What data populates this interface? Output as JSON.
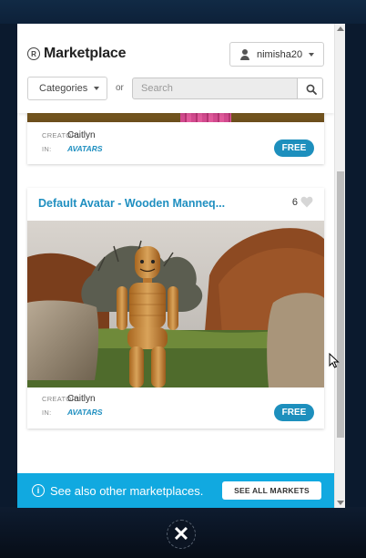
{
  "header": {
    "title": "Marketplace",
    "user_name": "nimisha20",
    "categories_label": "Categories",
    "or_label": "or",
    "search_placeholder": "Search"
  },
  "listings": [
    {
      "creator_key": "CREATOR:",
      "creator": "Caitlyn",
      "in_key": "IN:",
      "category": "AVATARS",
      "price_label": "FREE"
    },
    {
      "title": "Default Avatar - Wooden Manneq...",
      "likes": "6",
      "creator_key": "CREATOR:",
      "creator": "Caitlyn",
      "in_key": "IN:",
      "category": "AVATARS",
      "price_label": "FREE"
    }
  ],
  "banner": {
    "text": "See also other marketplaces.",
    "button_label": "SEE ALL MARKETS"
  },
  "colors": {
    "accent": "#1f8fc0",
    "banner": "#11a9e0",
    "free_button": "#1d8fbd"
  }
}
